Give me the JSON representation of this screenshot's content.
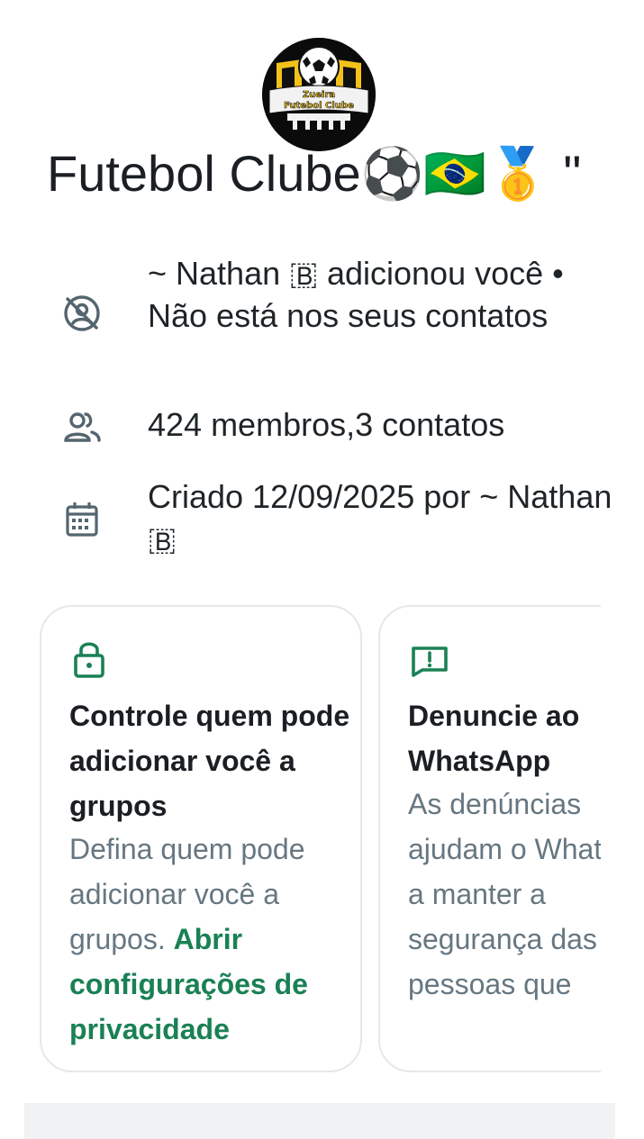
{
  "group": {
    "avatar_logo": "Zueira Futebol Clube",
    "title": "Futebol Clube⚽🇧🇷🥇 \""
  },
  "info": {
    "added_by": "~ Nathan 🇧 adicionou você • Não está nos seus contatos",
    "members": "424 membros,3 contatos",
    "created": "Criado 12/09/2025 por ~ Nathan 🇧"
  },
  "icons": {
    "not_contact": "contact-off-icon",
    "members": "group-icon",
    "created": "calendar-icon",
    "privacy": "lock-icon",
    "report": "report-flag-icon"
  },
  "cards": {
    "privacy": {
      "title": "Controle quem pode adicionar você a grupos",
      "body": "Defina quem pode adicionar você a grupos.",
      "link": "Abrir configurações de privacidade"
    },
    "report": {
      "title": "Denuncie ao WhatsApp",
      "body": "As denúncias ajudam o WhatsApp a manter a segurança das pessoas que"
    }
  },
  "colors": {
    "accent": "#1a8154",
    "text_primary": "#1b1f23",
    "text_secondary": "#667781",
    "icon": "#54656f",
    "card_border": "#e5e8ea"
  }
}
